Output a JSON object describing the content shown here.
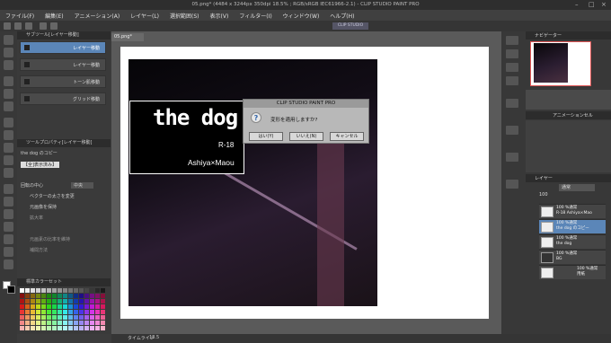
{
  "window": {
    "title": "05.png* (4484 x 3244px 350dpi 18.5% ; RGB/sRGB IEC61966-2.1) - CLIP STUDIO PAINT PRO"
  },
  "menu": [
    "ファイル(F)",
    "編集(E)",
    "アニメーション(A)",
    "レイヤー(L)",
    "選択範囲(S)",
    "表示(V)",
    "フィルター(I)",
    "ウィンドウ(W)",
    "ヘルプ(H)"
  ],
  "subtool": {
    "header": "サブツール[レイヤー移動]",
    "items": [
      "レイヤー移動",
      "レイヤー移動",
      "トーン肌移動",
      "グリッド移動"
    ]
  },
  "toolprop": {
    "header": "ツールプロパティ[レイヤー移動]",
    "layer_name": "the dog のコピー",
    "target_label": "【全]表示済み】",
    "rot_center_label": "回転の中心",
    "rot_center_value": "中央",
    "vector_label": "ベクターの太さを変更",
    "scale_label": "元画像を保持",
    "magnify_label": "拡大率",
    "keep_ratio_label": "元画素の比率を維持",
    "interp_label": "補間方法"
  },
  "colorset": {
    "header": "標準カラーセット"
  },
  "doc": {
    "tab": "05.png*",
    "title_text": "the dog",
    "rating": "R-18",
    "author": "Ashiya×Maou"
  },
  "dialog": {
    "title": "CLIP STUDIO PAINT PRO",
    "message": "変形を適用しますか?",
    "yes": "はい(Y)",
    "no": "いいえ(N)",
    "cancel": "キャンセル"
  },
  "statusbar": {
    "zoom": "18.5",
    "timeline": "タイムライン"
  },
  "right": {
    "navigator_tab": "ナビゲーター",
    "animation_tab": "アニメーションセル",
    "layer_tab": "レイヤー",
    "blend_mode": "通常",
    "opacity": "100"
  },
  "layers": [
    {
      "pct": "100 %通常",
      "name": "R-18 Ashiya×Mao"
    },
    {
      "pct": "100 %通常",
      "name": "the dog のコピー"
    },
    {
      "pct": "100 %通常",
      "name": "the dog"
    },
    {
      "pct": "100 %通常",
      "name": "BG"
    },
    {
      "pct": "100 %通常",
      "name": "用紙"
    }
  ],
  "top_right_button": "CLIP STUDIO"
}
